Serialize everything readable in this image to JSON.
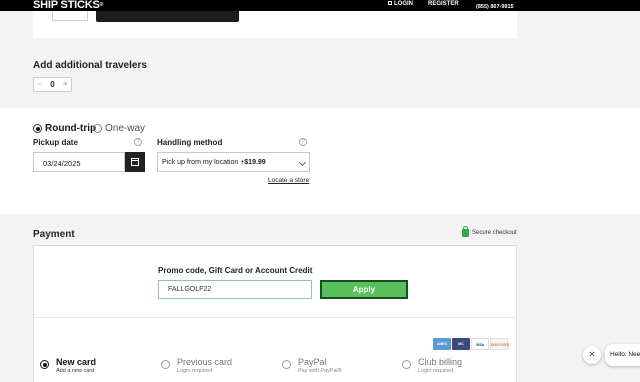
{
  "header": {
    "logo": "SHIP STICKS",
    "logo_mark": "®",
    "login": "LOGIN",
    "register": "REGISTER",
    "phone": "(855) 867-9915"
  },
  "travelers": {
    "title": "Add additional travelers",
    "count": "0"
  },
  "trip": {
    "round_trip_label": "Round-trip",
    "one_way_label": "One-way",
    "selected": "Round-trip",
    "pickup_date_label": "Pickup date",
    "pickup_date_value": "03/24/2025",
    "handling_label": "Handling method",
    "handling_value_prefix": "Pick up from my location +",
    "handling_value_price": "$19.99",
    "locate_link": "Locate a store"
  },
  "payment": {
    "title": "Payment",
    "secure": "Secure checkout",
    "promo_label": "Promo code, Gift Card or Account Credit",
    "promo_value": "FALLGOLF22",
    "apply_label": "Apply",
    "accepted_cards": [
      "AMEX",
      "MC",
      "VISA",
      "DISCOVER"
    ],
    "options": [
      {
        "title": "New card",
        "subtitle": "Add a new card",
        "selected": true
      },
      {
        "title": "Previous card",
        "subtitle": "Login required",
        "selected": false
      },
      {
        "title": "PayPal",
        "subtitle": "Pay with PayPal®",
        "selected": false
      },
      {
        "title": "Club billing",
        "subtitle": "Login required",
        "selected": false
      }
    ]
  },
  "chat": {
    "close": "✕",
    "message": "Hello. Need"
  },
  "colors": {
    "apply_green": "#58c05a",
    "secure_green": "#2fa84f",
    "header_black": "#000000"
  }
}
